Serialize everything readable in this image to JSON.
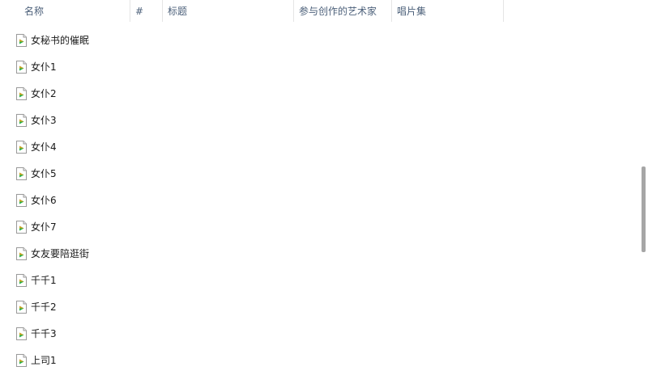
{
  "columns": {
    "name": "名称",
    "number": "#",
    "title": "标题",
    "artist": "参与创作的艺术家",
    "album": "唱片集"
  },
  "sort_indicator": "^",
  "files": [
    "女秘书的催眠",
    "女仆1",
    "女仆2",
    "女仆3",
    "女仆4",
    "女仆5",
    "女仆6",
    "女仆7",
    "女友要陪逛街",
    "千千1",
    "千千2",
    "千千3",
    "上司1"
  ],
  "icons": {
    "file": "media-file-icon",
    "accent_play": "#2bb24c",
    "accent_orange": "#f0a020"
  }
}
